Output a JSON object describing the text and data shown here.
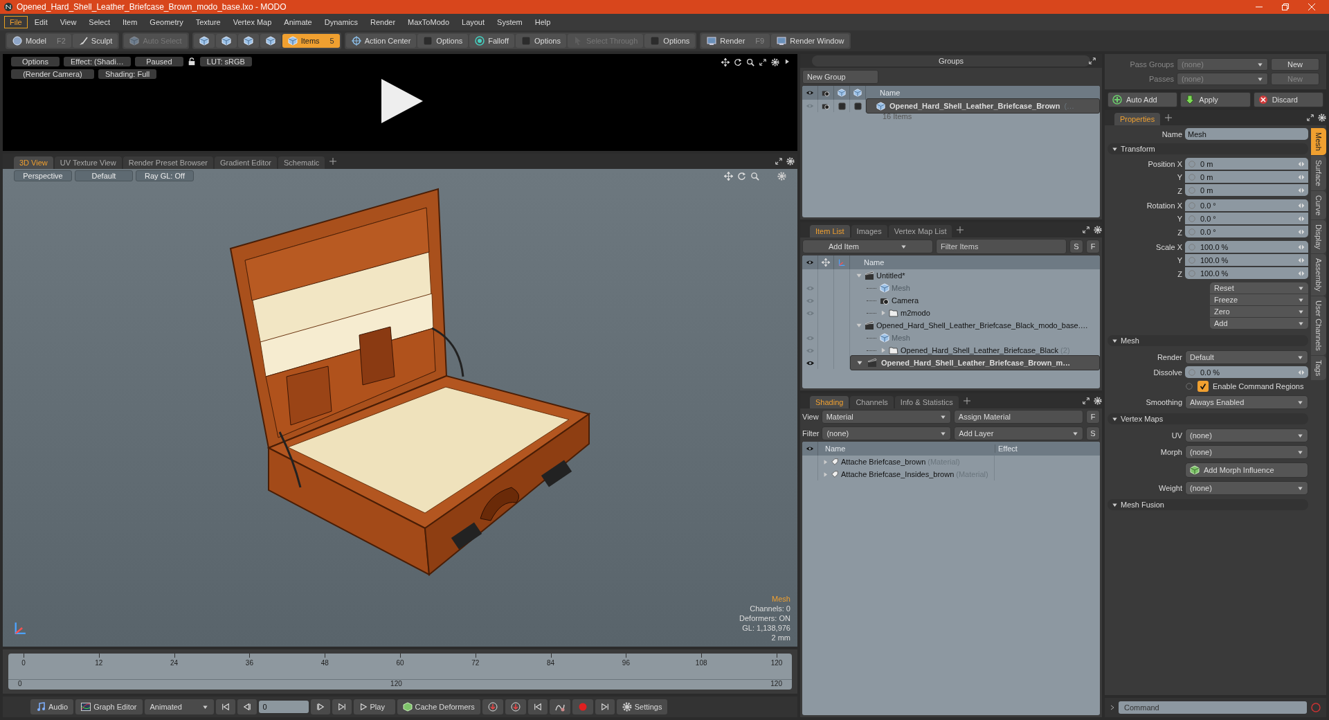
{
  "window": {
    "title": "Opened_Hard_Shell_Leather_Briefcase_Brown_modo_base.lxo - MODO"
  },
  "menu": [
    {
      "label": "File",
      "selected": true
    },
    {
      "label": "Edit",
      "selected": false
    },
    {
      "label": "View",
      "selected": false
    },
    {
      "label": "Select",
      "selected": false
    },
    {
      "label": "Item",
      "selected": false
    },
    {
      "label": "Geometry",
      "selected": false
    },
    {
      "label": "Texture",
      "selected": false
    },
    {
      "label": "Vertex Map",
      "selected": false
    },
    {
      "label": "Animate",
      "selected": false
    },
    {
      "label": "Dynamics",
      "selected": false
    },
    {
      "label": "Render",
      "selected": false
    },
    {
      "label": "MaxToModo",
      "selected": false
    },
    {
      "label": "Layout",
      "selected": false
    },
    {
      "label": "System",
      "selected": false
    },
    {
      "label": "Help",
      "selected": false
    }
  ],
  "toolbar": [
    [
      {
        "kind": "sphere",
        "label": "Model",
        "shortcut": "F2",
        "selected": false,
        "disabled": false
      },
      {
        "kind": "brush",
        "label": "Sculpt",
        "selected": false,
        "disabled": false
      }
    ],
    [
      {
        "kind": "cube",
        "label": "Auto Select",
        "selected": false,
        "disabled": true
      }
    ],
    [
      {
        "kind": "cube",
        "selected": false,
        "disabled": false
      },
      {
        "kind": "cube",
        "selected": false,
        "disabled": false
      },
      {
        "kind": "cube",
        "selected": false,
        "disabled": false
      },
      {
        "kind": "cube",
        "selected": false,
        "disabled": false
      },
      {
        "kind": "cube",
        "label": "Items",
        "shortcut": "5",
        "selected": true,
        "disabled": false
      }
    ],
    [
      {
        "kind": "target",
        "label": "Action Center",
        "selected": false,
        "disabled": false
      },
      {
        "kind": "square",
        "label": "Options",
        "selected": false,
        "disabled": false
      },
      {
        "kind": "rings",
        "label": "Falloff",
        "selected": false,
        "disabled": false
      },
      {
        "kind": "square",
        "label": "Options",
        "selected": false,
        "disabled": false
      },
      {
        "kind": "cursor",
        "label": "Select Through",
        "selected": false,
        "disabled": true
      },
      {
        "kind": "square",
        "label": "Options",
        "selected": false,
        "disabled": false
      }
    ],
    [
      {
        "kind": "monitor",
        "label": "Render",
        "shortcut": "F9",
        "selected": false,
        "disabled": false
      },
      {
        "kind": "monitor",
        "label": "Render Window",
        "selected": false,
        "disabled": false
      }
    ]
  ],
  "preview": {
    "controls_top": [
      "Options",
      "Effect: (Shadi…",
      "Paused",
      "LUT: sRGB"
    ],
    "controls_bottom": [
      "(Render Camera)",
      "Shading: Full"
    ]
  },
  "viewport": {
    "tabs": [
      {
        "label": "3D View",
        "selected": true
      },
      {
        "label": "UV Texture View",
        "selected": false
      },
      {
        "label": "Render Preset Browser",
        "selected": false
      },
      {
        "label": "Gradient Editor",
        "selected": false
      },
      {
        "label": "Schematic",
        "selected": false
      }
    ],
    "buttons": [
      "Perspective",
      "Default",
      "Ray GL: Off"
    ],
    "info": {
      "selection": "Mesh",
      "lines": [
        "Channels: 0",
        "Deformers: ON",
        "GL: 1,138,976",
        "2 mm"
      ]
    }
  },
  "timeline": {
    "ticks": [
      "0",
      "12",
      "24",
      "36",
      "48",
      "60",
      "72",
      "84",
      "96",
      "108",
      "120"
    ],
    "range_start": "0",
    "range_mid": "120",
    "range_end": "120"
  },
  "transport": {
    "audio": "Audio",
    "graph_editor": "Graph Editor",
    "mode": "Animated",
    "frame": "0",
    "play": "Play",
    "cache": "Cache Deformers",
    "settings": "Settings"
  },
  "groups": {
    "title": "Groups",
    "new_group": "New Group",
    "column": "Name",
    "rows": [
      {
        "name": "Opened_Hard_Shell_Leather_Briefcase_Brown",
        "suffix": "(…",
        "count": "16 Items"
      }
    ]
  },
  "item_list": {
    "tabs": [
      {
        "label": "Item List",
        "selected": true
      },
      {
        "label": "Images",
        "selected": false
      },
      {
        "label": "Vertex Map List",
        "selected": false
      }
    ],
    "add_item": "Add Item",
    "filter_placeholder": "Filter Items",
    "s": "S",
    "f": "F",
    "column": "Name",
    "tree": [
      {
        "kind": "scene",
        "label": "Untitled*",
        "expanded": true,
        "visible": false,
        "disabled": false,
        "active": false,
        "children": [
          {
            "kind": "mesh",
            "label": "Mesh",
            "visible": true,
            "disabled": true,
            "active": false
          },
          {
            "kind": "camera",
            "label": "Camera",
            "visible": true,
            "disabled": false,
            "active": false
          },
          {
            "kind": "folder",
            "label": "m2modo",
            "expanded": false,
            "visible": true,
            "disabled": false,
            "active": false
          }
        ]
      },
      {
        "kind": "scene",
        "label": "Opened_Hard_Shell_Leather_Briefcase_Black_modo_base.…",
        "expanded": true,
        "visible": false,
        "disabled": false,
        "active": false,
        "children": [
          {
            "kind": "mesh",
            "label": "Mesh",
            "visible": true,
            "disabled": true,
            "active": false
          },
          {
            "kind": "folder",
            "label": "Opened_Hard_Shell_Leather_Briefcase_Black",
            "count": "(2)",
            "expanded": false,
            "visible": true,
            "disabled": false,
            "active": false
          }
        ]
      },
      {
        "kind": "scene",
        "label": "Opened_Hard_Shell_Leather_Briefcase_Brown_m…",
        "expanded": true,
        "visible": true,
        "disabled": false,
        "active": true
      }
    ]
  },
  "shading": {
    "tabs": [
      {
        "label": "Shading",
        "selected": true
      },
      {
        "label": "Channels",
        "selected": false
      },
      {
        "label": "Info & Statistics",
        "selected": false
      }
    ],
    "view_label": "View",
    "view": "Material",
    "assign": "Assign Material",
    "f": "F",
    "filter_label": "Filter",
    "filter": "(none)",
    "add_layer": "Add Layer",
    "s": "S",
    "columns": [
      "Name",
      "Effect"
    ],
    "rows": [
      {
        "name": "Attache Briefcase_brown",
        "type": "(Material)",
        "expanded": false
      },
      {
        "name": "Attache Briefcase_Insides_brown",
        "type": "(Material)",
        "expanded": false
      }
    ]
  },
  "passes": {
    "rows": [
      {
        "label": "Pass Groups",
        "value": "(none)",
        "button": "New",
        "disabled": false
      },
      {
        "label": "Passes",
        "value": "(none)",
        "button": "New",
        "disabled": true
      }
    ],
    "actions": [
      "Auto Add",
      "Apply",
      "Discard"
    ]
  },
  "properties": {
    "tab": "Properties",
    "name_label": "Name",
    "name": "Mesh",
    "sections": [
      {
        "title": "Transform",
        "rows": [
          {
            "kind": "vector",
            "fields": [
              {
                "label": "Position X",
                "value": "0 m"
              },
              {
                "label": "Y",
                "value": "0 m"
              },
              {
                "label": "Z",
                "value": "0 m"
              }
            ]
          },
          {
            "kind": "vector",
            "fields": [
              {
                "label": "Rotation X",
                "value": "0.0 °"
              },
              {
                "label": "Y",
                "value": "0.0 °"
              },
              {
                "label": "Z",
                "value": "0.0 °"
              }
            ]
          },
          {
            "kind": "vector",
            "fields": [
              {
                "label": "Scale X",
                "value": "100.0 %"
              },
              {
                "label": "Y",
                "value": "100.0 %"
              },
              {
                "label": "Z",
                "value": "100.0 %"
              }
            ]
          },
          {
            "kind": "menus",
            "items": [
              "Reset",
              "Freeze",
              "Zero",
              "Add"
            ]
          }
        ]
      },
      {
        "title": "Mesh",
        "rows": [
          {
            "kind": "dropdown",
            "label": "Render",
            "value": "Default"
          },
          {
            "kind": "field",
            "label": "Dissolve",
            "value": "0.0 %"
          },
          {
            "kind": "check",
            "label": "Enable Command Regions",
            "checked": true
          },
          {
            "kind": "dropdown",
            "label": "Smoothing",
            "value": "Always Enabled"
          }
        ]
      },
      {
        "title": "Vertex Maps",
        "rows": [
          {
            "kind": "dropdown",
            "label": "UV",
            "value": "(none)"
          },
          {
            "kind": "dropdown",
            "label": "Morph",
            "value": "(none)"
          },
          {
            "kind": "button",
            "label": "Add Morph Influence"
          },
          {
            "kind": "dropdown",
            "label": "Weight",
            "value": "(none)"
          }
        ]
      },
      {
        "title": "Mesh Fusion"
      }
    ],
    "side_tabs": [
      {
        "label": "Mesh",
        "selected": true
      },
      {
        "label": "Surface",
        "selected": false
      },
      {
        "label": "Curve",
        "selected": false
      },
      {
        "label": "Display",
        "selected": false
      },
      {
        "label": "Assembly",
        "selected": false
      },
      {
        "label": "User Channels",
        "selected": false
      },
      {
        "label": "Tags",
        "selected": false
      }
    ]
  },
  "command": {
    "placeholder": "Command"
  }
}
